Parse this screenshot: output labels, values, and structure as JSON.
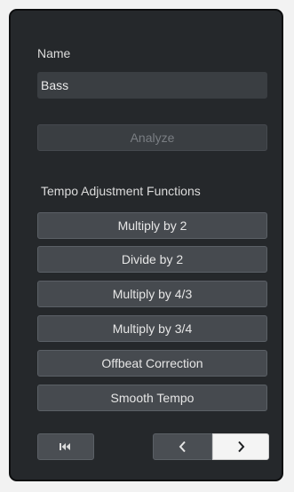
{
  "name_section": {
    "label": "Name",
    "value": "Bass"
  },
  "analyze_button": {
    "label": "Analyze",
    "enabled": false
  },
  "tempo_functions": {
    "heading": "Tempo Adjustment Functions",
    "buttons": [
      {
        "label": "Multiply by 2"
      },
      {
        "label": "Divide by 2"
      },
      {
        "label": "Multiply by 4/3"
      },
      {
        "label": "Multiply by 3/4"
      },
      {
        "label": "Offbeat Correction"
      },
      {
        "label": "Smooth Tempo"
      }
    ]
  },
  "navigation": {
    "first_icon": "skip-to-start-icon",
    "previous_icon": "chevron-left-icon",
    "next_icon": "chevron-right-icon",
    "active": "next"
  },
  "colors": {
    "panel_background": "#25282b",
    "button_background": "#464a4f",
    "active_nav_background": "#f4f4f4"
  }
}
